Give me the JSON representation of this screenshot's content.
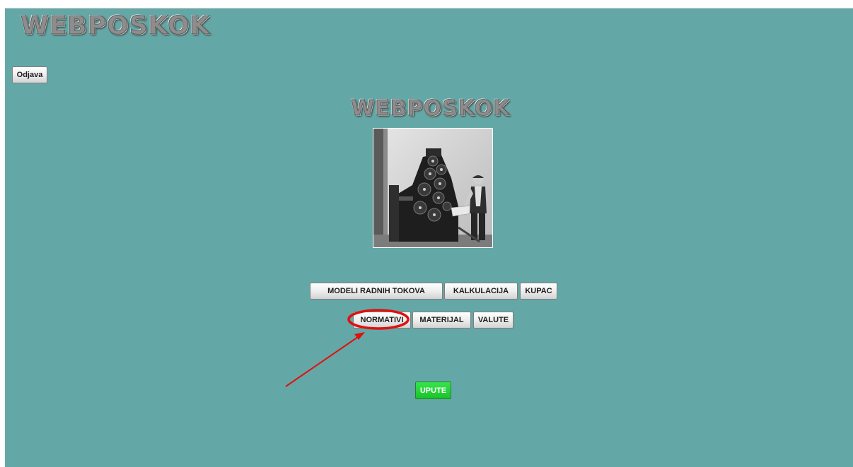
{
  "header": {
    "logo_text": "WEBPOSKOK",
    "logout_label": "Odjava"
  },
  "main": {
    "logo_text": "WEBPOSKOK",
    "photo_icon": "vintage-printing-press-photo",
    "menu_row1": [
      {
        "label": "MODELI RADNIH TOKOVA"
      },
      {
        "label": "KALKULACIJA"
      },
      {
        "label": "KUPAC"
      }
    ],
    "menu_row2": [
      {
        "label": "NORMATIVI"
      },
      {
        "label": "MATERIJAL"
      },
      {
        "label": "VALUTE"
      }
    ],
    "help_label": "UPUTE"
  },
  "colors": {
    "background": "#63a8a6",
    "help_button": "#19c427",
    "annotation": "#e01010"
  },
  "annotation": {
    "highlighted_item": "NORMATIVI"
  }
}
